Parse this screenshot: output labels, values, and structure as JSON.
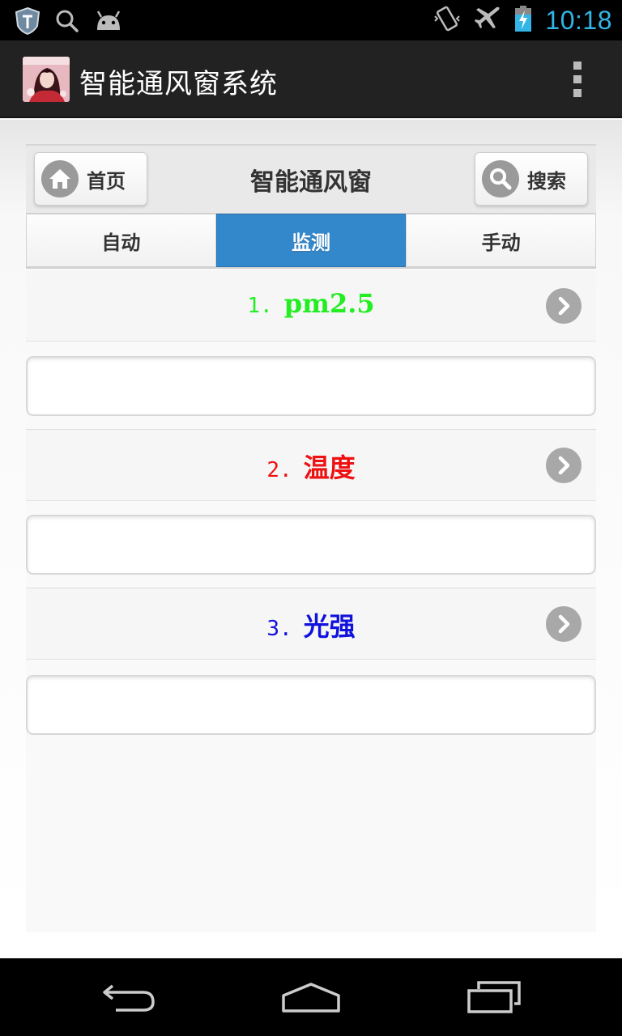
{
  "status_bar": {
    "time": "10:18",
    "icons": [
      "shield-icon",
      "search-icon",
      "android-icon",
      "vibrate-icon",
      "airplane-icon",
      "battery-charging-icon"
    ],
    "accent": "#33b5e5"
  },
  "action_bar": {
    "title": "智能通风窗系统",
    "icon": "app-avatar-icon",
    "menu_icon": "overflow-menu-icon"
  },
  "header": {
    "home_label": "首页",
    "title": "智能通风窗",
    "search_label": "搜索"
  },
  "tabs": [
    {
      "label": "自动",
      "active": false
    },
    {
      "label": "监测",
      "active": true
    },
    {
      "label": "手动",
      "active": false
    }
  ],
  "sections": [
    {
      "num": "1.",
      "label": "pm2.5",
      "color": "#22ee22",
      "value": ""
    },
    {
      "num": "2.",
      "label": "温度",
      "color": "#ee1111",
      "value": ""
    },
    {
      "num": "3.",
      "label": "光强",
      "color": "#1111dd",
      "value": ""
    }
  ],
  "colors": {
    "tab_active": "#3388cc"
  },
  "nav_bar": {
    "icons": [
      "back-icon",
      "home-icon",
      "recent-apps-icon"
    ]
  }
}
